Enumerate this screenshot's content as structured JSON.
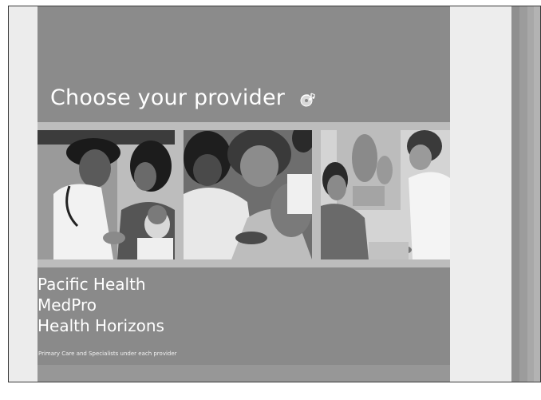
{
  "slide": {
    "title": "Choose your provider",
    "title_icon": "sound-icon",
    "photos": [
      {
        "name": "doctor-mother-child-photo"
      },
      {
        "name": "doctor-patient-arm-photo"
      },
      {
        "name": "doctor-consultation-photo"
      }
    ],
    "providers": [
      "Pacific Health",
      "MedPro",
      "Health Horizons"
    ],
    "note": "Primary Care and Specialists under each provider"
  }
}
